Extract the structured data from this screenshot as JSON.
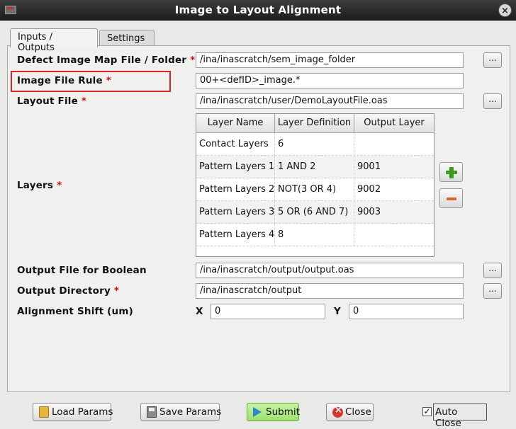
{
  "window": {
    "title": "Image to Layout Alignment",
    "close_glyph": "×"
  },
  "tabs": [
    {
      "label": "Inputs / Outputs",
      "active": true
    },
    {
      "label": "Settings",
      "active": false
    }
  ],
  "required_mark": "*",
  "browse_label": "...",
  "form": {
    "defect_image_map": {
      "label": "Defect Image Map File / Folder",
      "value": "/ina/inascratch/sem_image_folder"
    },
    "image_file_rule": {
      "label": "Image File Rule",
      "value": "00+<defID>_image.*"
    },
    "layout_file": {
      "label": "Layout File",
      "value": "/ina/inascratch/user/DemoLayoutFile.oas"
    },
    "layers": {
      "label": "Layers",
      "columns": [
        "Layer Name",
        "Layer Definition",
        "Output Layer"
      ],
      "rows": [
        [
          "Contact Layers",
          "6",
          ""
        ],
        [
          "Pattern Layers 1",
          "1 AND 2",
          "9001"
        ],
        [
          "Pattern Layers 2",
          "NOT(3 OR 4)",
          "9002"
        ],
        [
          "Pattern Layers 3",
          "5 OR (6 AND 7)",
          "9003"
        ],
        [
          "Pattern Layers 4",
          "8",
          ""
        ]
      ]
    },
    "output_file_boolean": {
      "label": "Output File for Boolean",
      "value": "/ina/inascratch/output/output.oas"
    },
    "output_directory": {
      "label": "Output Directory",
      "value": "/ina/inascratch/output"
    },
    "alignment_shift": {
      "label": "Alignment Shift (um)",
      "x_label": "X",
      "x_value": "0",
      "y_label": "Y",
      "y_value": "0"
    }
  },
  "buttons": {
    "load_params": "Load Params",
    "save_params": "Save Params",
    "submit": "Submit",
    "close": "Close"
  },
  "auto_close": {
    "label": "Auto Close",
    "checked": true,
    "check_glyph": "✓"
  },
  "colors": {
    "required": "#d01010",
    "highlight": "#d9232b",
    "add": "#3c9a21",
    "remove": "#e0642a",
    "submit": "#9fe06e"
  },
  "icons": [
    "app-icon",
    "window-close-icon",
    "folder-icon",
    "save-icon",
    "submit-arrow-icon",
    "close-circle-icon",
    "plus-icon",
    "minus-icon",
    "checkbox-icon"
  ]
}
